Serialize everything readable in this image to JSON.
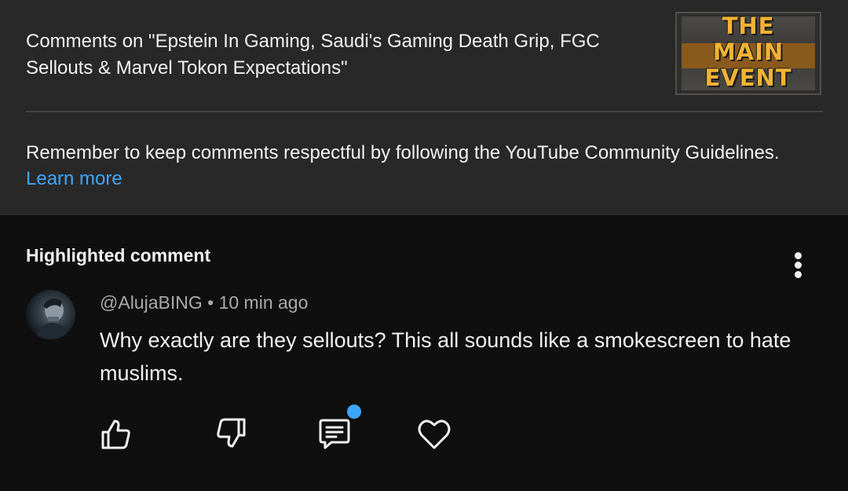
{
  "header": {
    "title": "Comments on \"Epstein In Gaming, Saudi's Gaming Death Grip, FGC Sellouts & Marvel Tokon Expectations\"",
    "thumbnail_text": [
      "THE",
      "MAIN",
      "EVENT"
    ]
  },
  "guidelines": {
    "text": "Remember to keep comments respectful by following the YouTube Community Guidelines.",
    "learn_more": "Learn more"
  },
  "highlighted": {
    "heading": "Highlighted comment",
    "comment": {
      "author": "@AlujaBING",
      "separator": "•",
      "time": "10 min ago",
      "text": "Why exactly are they sellouts? This all sounds like a smokescreen to hate muslims."
    }
  },
  "actions": {
    "like_icon": "thumbs-up-icon",
    "dislike_icon": "thumbs-down-icon",
    "reply_icon": "reply-icon",
    "heart_icon": "heart-icon"
  },
  "colors": {
    "panel_bg": "#282828",
    "page_bg": "#0f0f0f",
    "link": "#3ea6ff",
    "notification_dot": "#3ea6ff"
  }
}
